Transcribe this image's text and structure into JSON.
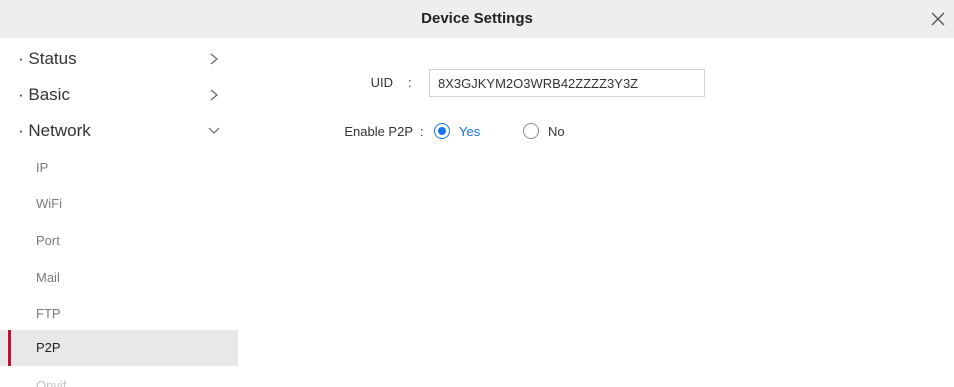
{
  "window": {
    "title": "Device Settings"
  },
  "sidebar": {
    "sections": [
      {
        "label": "· Status",
        "chevron": "chevron-right-icon"
      },
      {
        "label": "· Basic",
        "chevron": "chevron-right-icon"
      },
      {
        "label": "· Network",
        "chevron": "chevron-down-icon"
      }
    ],
    "network_items": [
      {
        "label": "IP"
      },
      {
        "label": "WiFi"
      },
      {
        "label": "Port"
      },
      {
        "label": "Mail"
      },
      {
        "label": "FTP"
      },
      {
        "label": "P2P",
        "active": true
      },
      {
        "label": "Onvif"
      }
    ]
  },
  "form": {
    "uid_label": "UID",
    "uid_value": "8X3GJKYM2O3WRB42ZZZZ3Y3Z",
    "colon": ":",
    "p2p_label": "Enable P2P",
    "p2p_options": [
      {
        "label": "Yes",
        "checked": true
      },
      {
        "label": "No",
        "checked": false
      }
    ]
  },
  "colors": {
    "accent": "#1a73e8",
    "active_marker": "#c8102e",
    "titlebar": "#eeeeee",
    "active_background": "#e8e8e8"
  }
}
